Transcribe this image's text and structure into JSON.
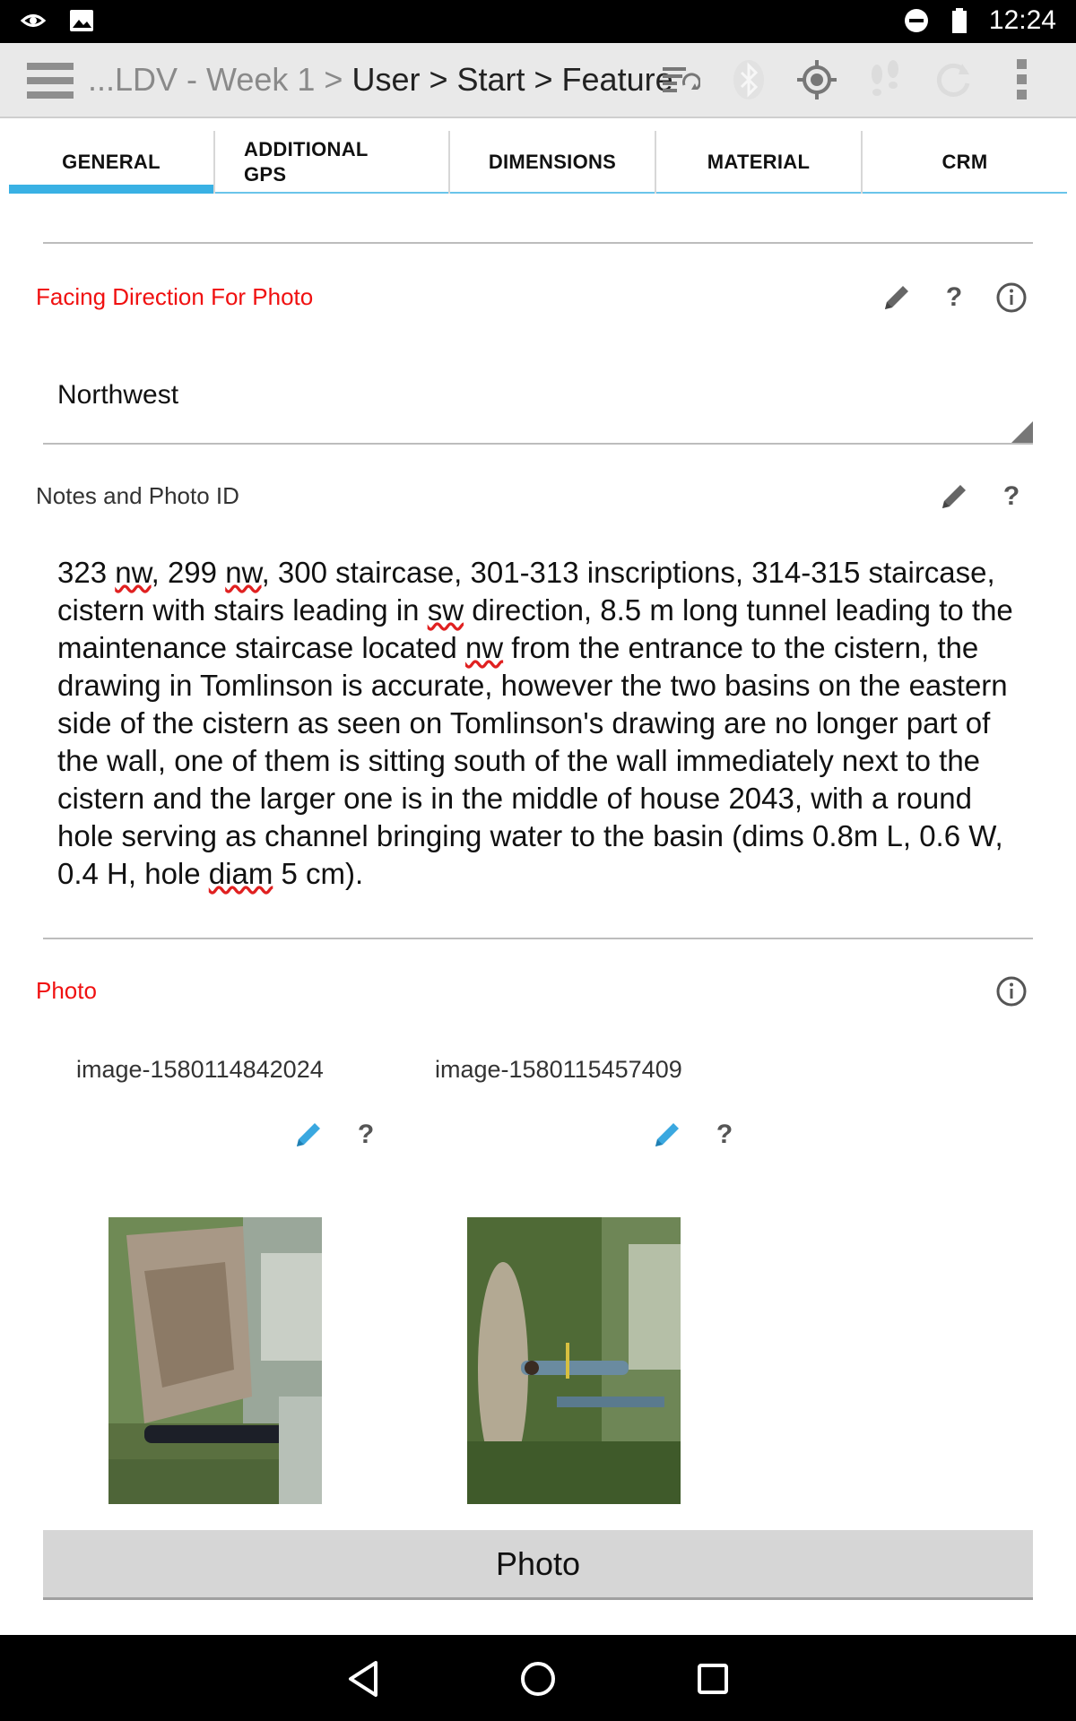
{
  "status_bar": {
    "time": "12:24",
    "left_icons": [
      "nvidia-icon",
      "image-icon"
    ],
    "right_icons": [
      "do-not-disturb-icon",
      "battery-icon"
    ]
  },
  "app_bar": {
    "breadcrumb_dim": "...LDV - Week 1 > ",
    "breadcrumb_main": "User > Start > Feature",
    "icons": [
      "sync-list-icon",
      "bluetooth-icon",
      "gps-target-icon",
      "footsteps-icon",
      "refresh-icon",
      "overflow-menu-icon"
    ]
  },
  "tabs": [
    {
      "label": "GENERAL",
      "active": true
    },
    {
      "label": "ADDITIONAL GPS",
      "active": false
    },
    {
      "label": "DIMENSIONS",
      "active": false
    },
    {
      "label": "MATERIAL",
      "active": false
    },
    {
      "label": "CRM",
      "active": false
    }
  ],
  "facing_direction": {
    "label": "Facing Direction For Photo",
    "value": "Northwest"
  },
  "notes": {
    "label": "Notes and Photo ID",
    "segments": [
      {
        "t": "323 ",
        "sq": false
      },
      {
        "t": "nw",
        "sq": true
      },
      {
        "t": ", 299 ",
        "sq": false
      },
      {
        "t": "nw",
        "sq": true
      },
      {
        "t": ", 300 staircase, 301-313 inscriptions, 314-315 staircase, cistern with stairs leading in ",
        "sq": false
      },
      {
        "t": "sw",
        "sq": true
      },
      {
        "t": " direction, 8.5 m long tunnel leading to the maintenance staircase located ",
        "sq": false
      },
      {
        "t": "nw",
        "sq": true
      },
      {
        "t": " from the entrance to the cistern, the drawing in Tomlinson is accurate, however the two basins on the eastern side of the cistern as seen on Tomlinson's drawing are no longer part of the wall, one of them is sitting south of the wall immediately next to the cistern and the larger one is in the middle of house 2043, with a round hole serving as channel bringing water to the basin (dims 0.8m L, 0.6 W, 0.4 H, hole ",
        "sq": false
      },
      {
        "t": "diam",
        "sq": true
      },
      {
        "t": " 5 cm).",
        "sq": false
      }
    ]
  },
  "photo": {
    "label": "Photo",
    "images": [
      {
        "name": "image-1580114842024"
      },
      {
        "name": "image-1580115457409"
      }
    ],
    "button_label": "Photo"
  },
  "help_glyph": "?",
  "colors": {
    "accent": "#39b1e4",
    "required_label": "#f01010",
    "edit_pencil_blue": "#3aa8e0"
  }
}
